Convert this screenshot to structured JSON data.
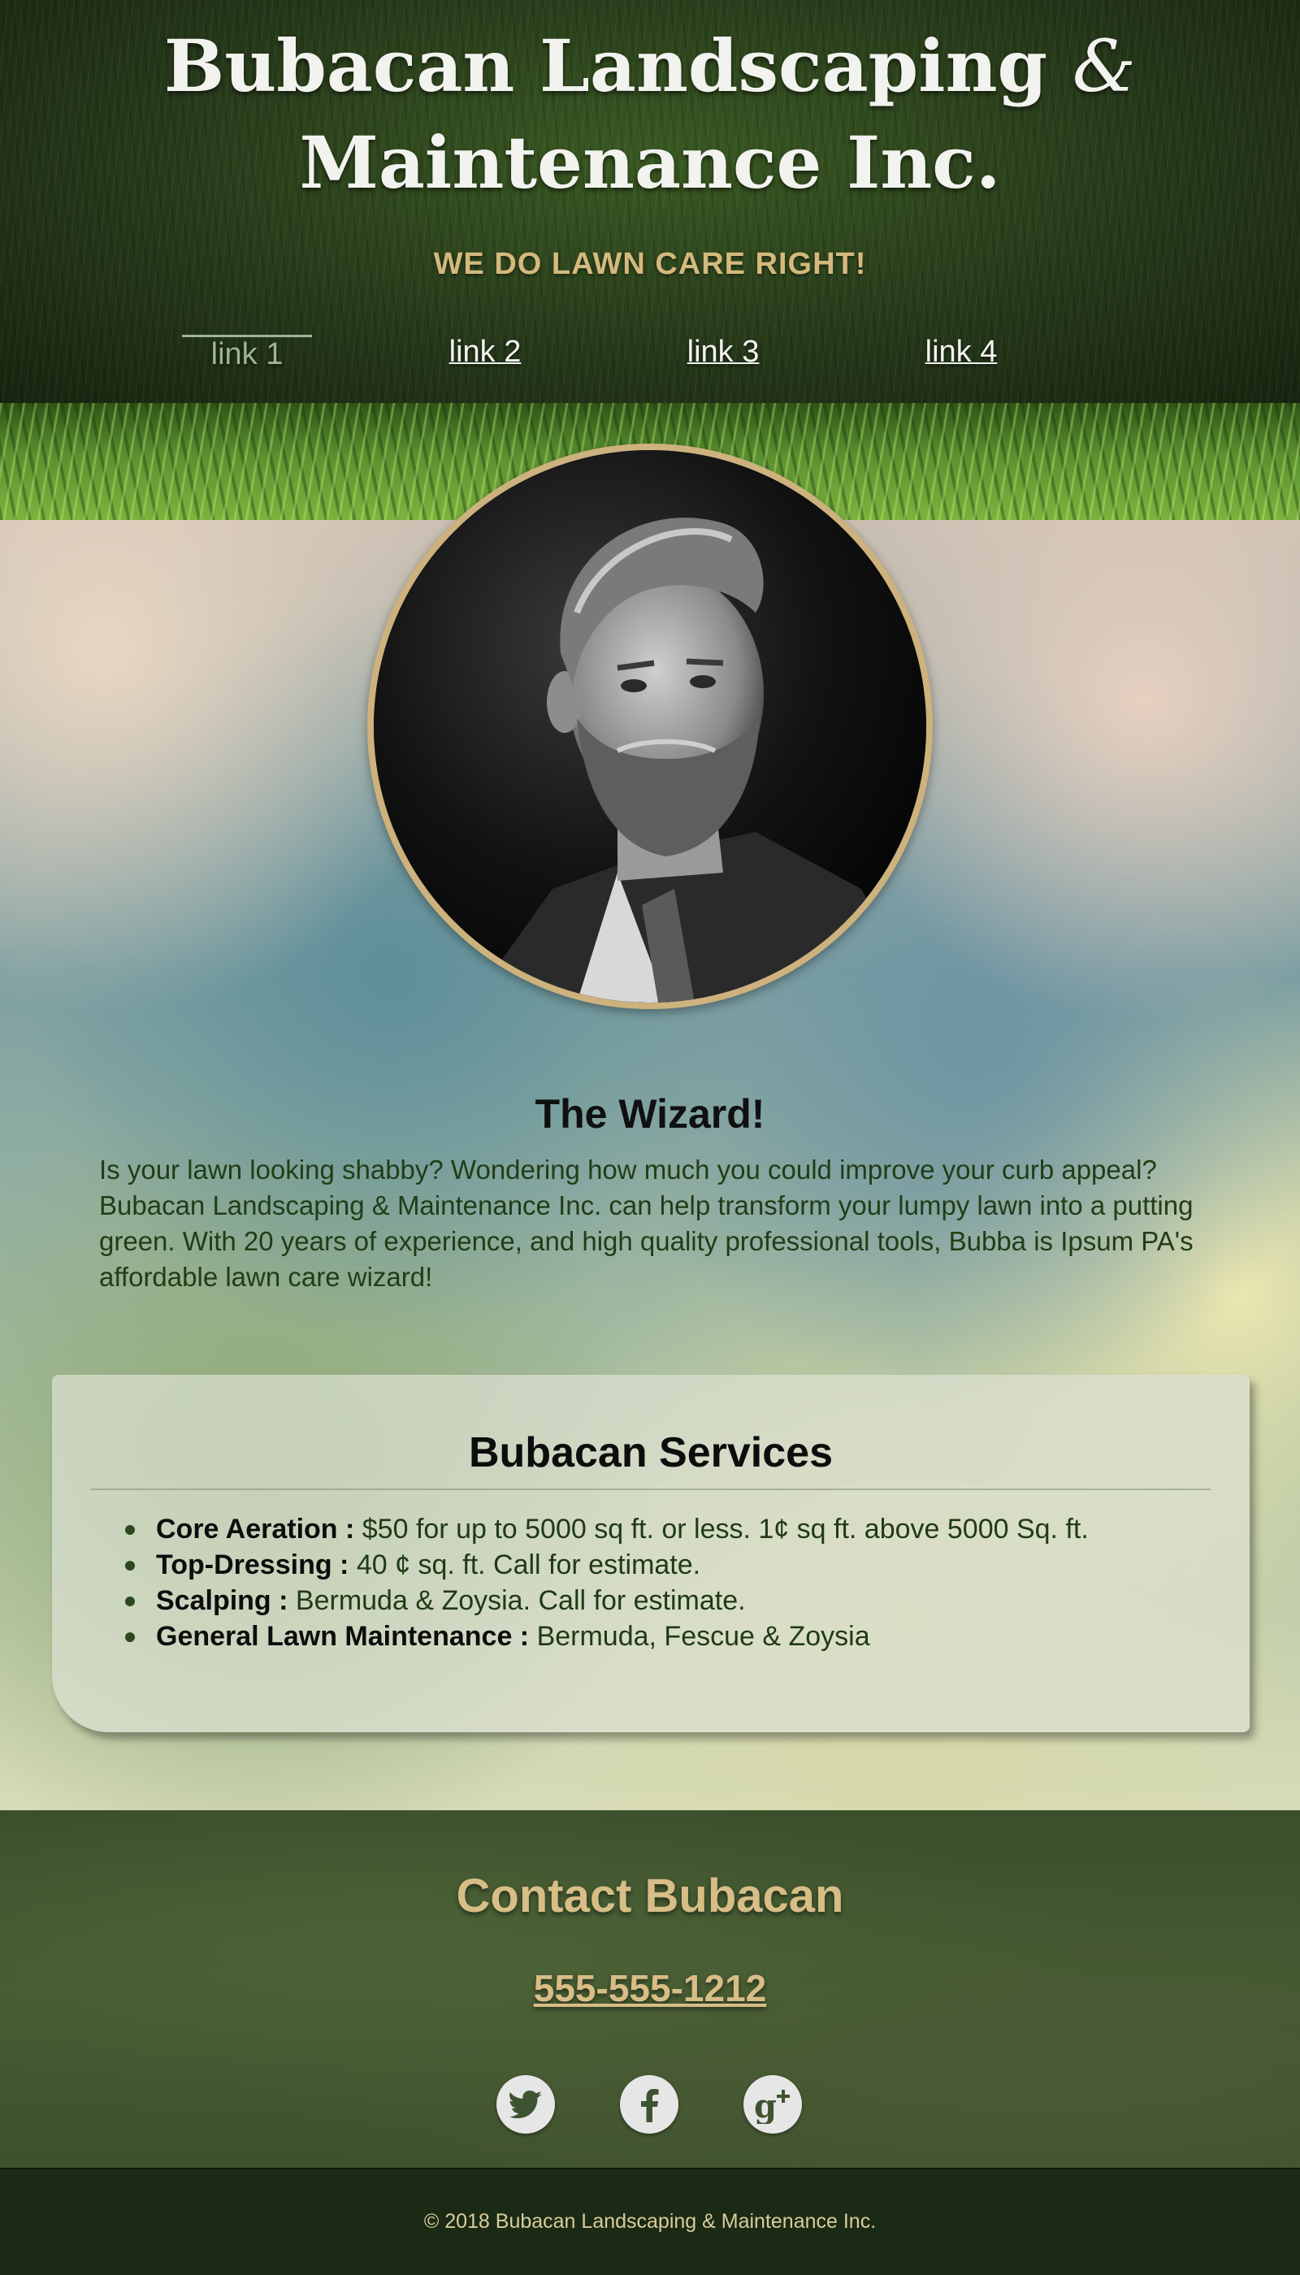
{
  "header": {
    "title_line1": "Bubacan Landscaping",
    "title_amp": "&",
    "title_line2": "Maintenance Inc.",
    "tagline": "WE DO LAWN CARE RIGHT!"
  },
  "nav": {
    "links": [
      {
        "label": "link 1",
        "active": true
      },
      {
        "label": "link 2",
        "active": false
      },
      {
        "label": "link 3",
        "active": false
      },
      {
        "label": "link 4",
        "active": false
      }
    ]
  },
  "about": {
    "title": "The Wizard!",
    "text": "Is your lawn looking shabby? Wondering how much you could improve your curb appeal? Bubacan Landscaping & Maintenance Inc. can help transform your lumpy lawn into a putting green. With 20 years of experience, and high quality professional tools, Bubba is Ipsum PA's affordable lawn care wizard!"
  },
  "services": {
    "title": "Bubacan Services",
    "items": [
      {
        "name": "Core Aeration :",
        "detail": " $50 for up to 5000 sq ft. or less. 1¢ sq ft. above 5000 Sq. ft."
      },
      {
        "name": "Top-Dressing :",
        "detail": " 40 ¢ sq. ft. Call for estimate."
      },
      {
        "name": "Scalping :",
        "detail": " Bermuda & Zoysia. Call for estimate."
      },
      {
        "name": "General Lawn Maintenance :",
        "detail": " Bermuda, Fescue & Zoysia"
      }
    ]
  },
  "contact": {
    "title": "Contact Bubacan",
    "phone": "555-555-1212",
    "social": [
      "twitter-icon",
      "facebook-icon",
      "google-plus-icon"
    ]
  },
  "footer": {
    "copyright": "© 2018 Bubacan Landscaping & Maintenance Inc."
  },
  "colors": {
    "accent_gold": "#d7bd86",
    "portrait_border": "#cdb27e",
    "body_text_green": "#213d16",
    "footer_bg": "#1b2a14"
  }
}
